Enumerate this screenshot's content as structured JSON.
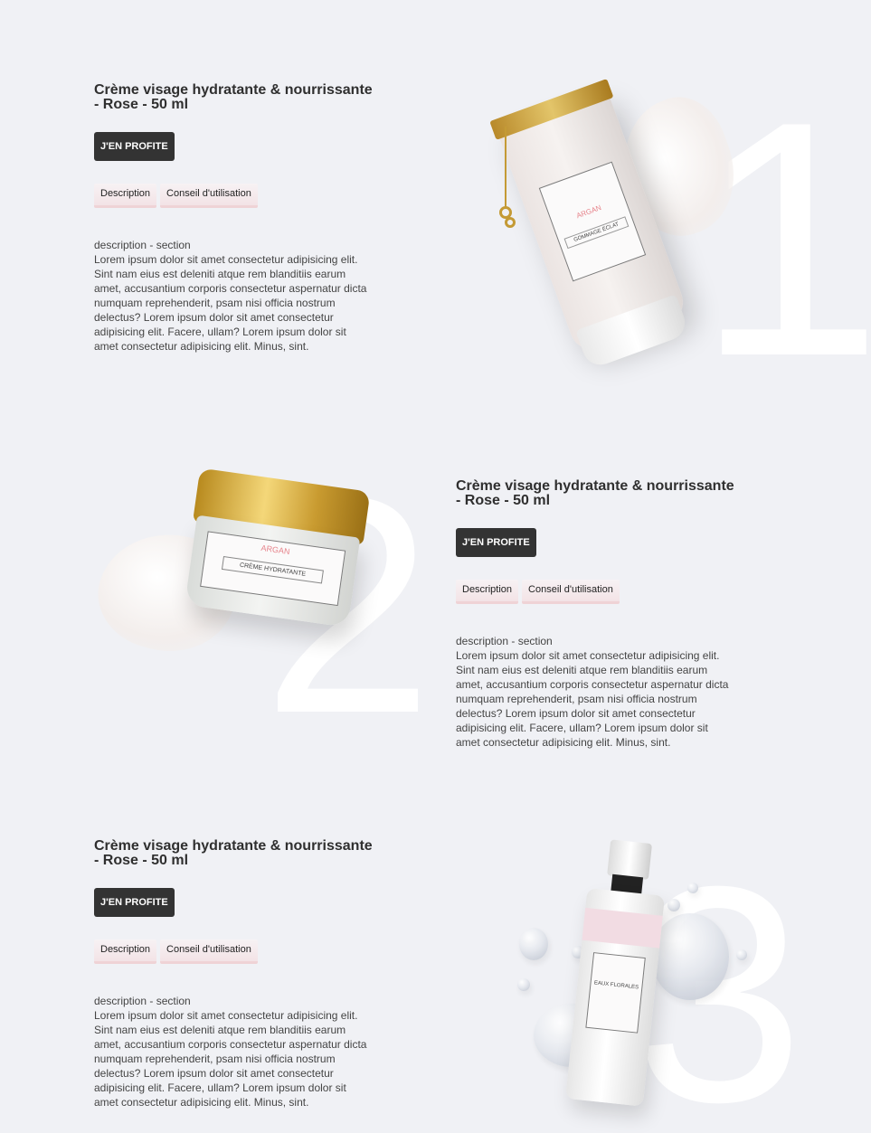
{
  "products": [
    {
      "number": "1",
      "title": "Crème visage hydratante & nourrissante - Rose - 50 ml",
      "cta_label": "J'EN PROFITE",
      "tabs": [
        "Description",
        "Conseil d'utilisation"
      ],
      "description_heading": "description - section",
      "description_text": "Lorem ipsum dolor sit amet consectetur adipisicing elit. Sint nam eius est deleniti atque rem blanditiis earum amet, accusantium corporis consectetur aspernatur dicta numquam reprehenderit, psam nisi officia nostrum delectus? Lorem ipsum dolor sit amet consectetur adipisicing elit. Facere, ullam? Lorem ipsum dolor sit amet consectetur adipisicing elit. Minus, sint.",
      "image": "argan-tube-product",
      "image_label_brand": "ARGAN",
      "image_label_name": "GOMMAGE ÉCLAT"
    },
    {
      "number": "2",
      "title": "Crème visage hydratante & nourrissante - Rose - 50 ml",
      "cta_label": "J'EN PROFITE",
      "tabs": [
        "Description",
        "Conseil d'utilisation"
      ],
      "description_heading": "description - section",
      "description_text": "Lorem ipsum dolor sit amet consectetur adipisicing elit. Sint nam eius est deleniti atque rem blanditiis earum amet, accusantium corporis consectetur aspernatur dicta numquam reprehenderit, psam nisi officia nostrum delectus? Lorem ipsum dolor sit amet consectetur adipisicing elit. Facere, ullam? Lorem ipsum dolor sit amet consectetur adipisicing elit. Minus, sint.",
      "image": "argan-jar-product",
      "image_label_brand": "ARGAN",
      "image_label_name": "CRÈME HYDRATANTE"
    },
    {
      "number": "3",
      "title": "Crème visage hydratante & nourrissante - Rose - 50 ml",
      "cta_label": "J'EN PROFITE",
      "tabs": [
        "Description",
        "Conseil d'utilisation"
      ],
      "description_heading": "description - section",
      "description_text": "Lorem ipsum dolor sit amet consectetur adipisicing elit. Sint nam eius est deleniti atque rem blanditiis earum amet, accusantium corporis consectetur aspernatur dicta numquam reprehenderit, psam nisi officia nostrum delectus? Lorem ipsum dolor sit amet consectetur adipisicing elit. Facere, ullam? Lorem ipsum dolor sit amet consectetur adipisicing elit. Minus, sint.",
      "image": "eaux-florales-bottle-product",
      "image_label_brand": "EAUX FLORALES"
    }
  ],
  "colors": {
    "background": "#f0f1f5",
    "button_bg": "#333333",
    "button_text": "#ffffff",
    "tab_accent": "#efd3d6",
    "number_color": "#ffffff"
  }
}
